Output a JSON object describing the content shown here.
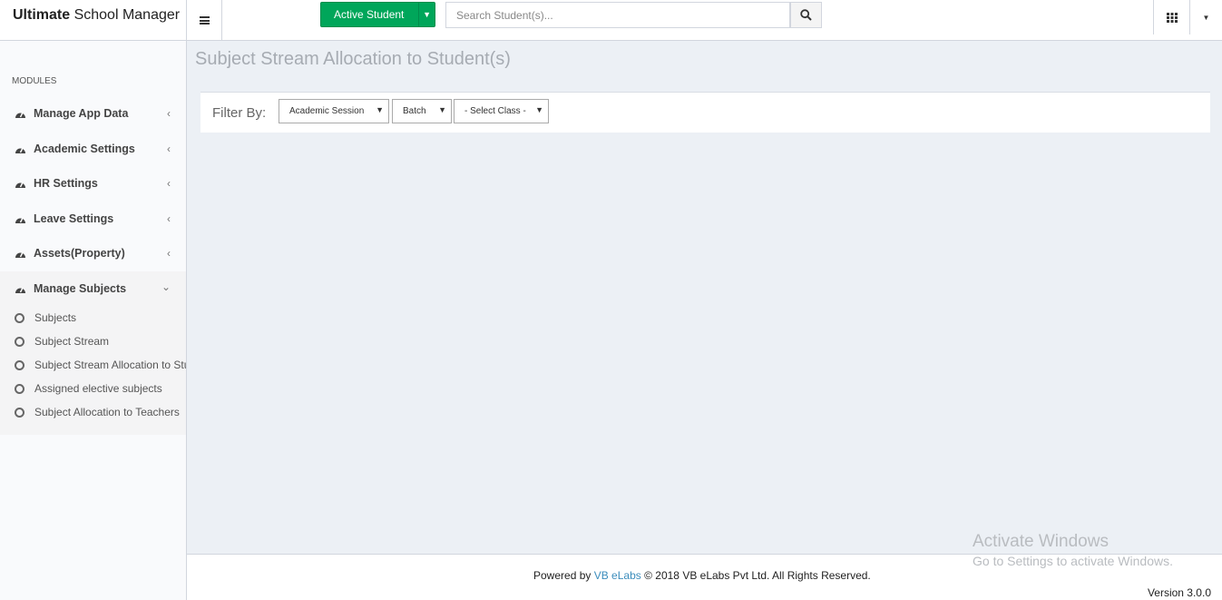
{
  "header": {
    "brand_bold": "Ultimate",
    "brand_rest": " School Manager",
    "active_button_label": "Active Student",
    "search_placeholder": "Search Student(s)..."
  },
  "sidebar": {
    "section_header": "MODULES",
    "items": [
      {
        "label": "Manage App Data",
        "icon": "dashboard-icon",
        "state": "collapsed"
      },
      {
        "label": "Academic Settings",
        "icon": "dashboard-icon",
        "state": "collapsed"
      },
      {
        "label": "HR Settings",
        "icon": "dashboard-icon",
        "state": "collapsed"
      },
      {
        "label": "Leave Settings",
        "icon": "dashboard-icon",
        "state": "collapsed"
      },
      {
        "label": "Assets(Property)",
        "icon": "dashboard-icon",
        "state": "collapsed"
      },
      {
        "label": "Manage Subjects",
        "icon": "dashboard-icon",
        "state": "expanded"
      }
    ],
    "subitems": [
      {
        "label": "Subjects"
      },
      {
        "label": "Subject Stream"
      },
      {
        "label": "Subject Stream Allocation to Student(s)"
      },
      {
        "label": "Assigned elective subjects"
      },
      {
        "label": "Subject Allocation to Teachers"
      }
    ]
  },
  "main": {
    "page_title": "Subject Stream Allocation to Student(s)",
    "filter": {
      "label": "Filter By:",
      "academic_session": "Academic Session",
      "batch": "Batch",
      "class": "- Select Class -"
    }
  },
  "footer": {
    "powered_by": "Powered by",
    "company_link": "VB eLabs",
    "copyright": "© 2018 VB eLabs Pvt Ltd. All Rights Reserved.",
    "version": "Version 3.0.0"
  },
  "watermark": {
    "line1": "Activate Windows",
    "line2": "Go to Settings to activate Windows."
  },
  "colors": {
    "accent_green": "#00a65a",
    "link_blue": "#3c8dbc",
    "content_bg": "#ecf0f5"
  }
}
